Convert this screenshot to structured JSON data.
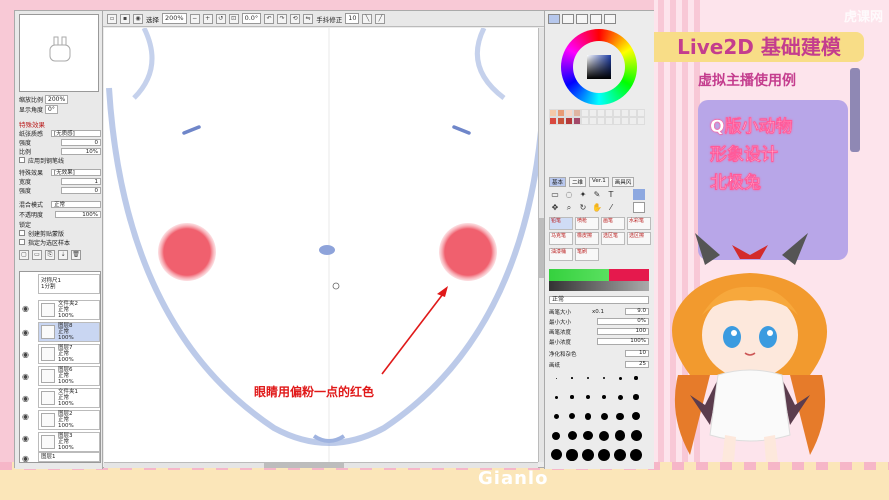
{
  "toolbar": {
    "select_label": "选择",
    "zoom": "200%",
    "angle": "0.0°",
    "stabilizer_label": "手抖修正",
    "stabilizer_value": "10"
  },
  "left_panel": {
    "zoom_label": "缩放比例",
    "zoom_value": "200%",
    "rotate_label": "显示角度",
    "rotate_value": "0°",
    "section_effects": "特殊效果",
    "paper_label": "纸张质感",
    "paper_value": "[无质感]",
    "strength_label": "强度",
    "strength_value": "0",
    "scale_label": "比例",
    "scale_value": "10%",
    "apply_brush": "应用到钢笔线",
    "effect_label": "特殊效果",
    "effect_value": "[无效果]",
    "width_label": "宽度",
    "width_value": "1",
    "effect_strength_label": "强度",
    "effect_strength_value": "0",
    "blend_label": "混合模式",
    "blend_value": "正常",
    "opacity_label": "不透明度",
    "opacity_value": "100%",
    "lock_label": "锁定",
    "clip_label": "创建剪贴蒙版",
    "select_source_label": "指定为选区样本"
  },
  "layers": [
    {
      "name": "对称尺1",
      "mode": "1分割",
      "opacity": "",
      "selected": false
    },
    {
      "name": "文件夹2",
      "mode": "正常",
      "opacity": "100%",
      "selected": false
    },
    {
      "name": "图层8",
      "mode": "正常",
      "opacity": "100%",
      "selected": true
    },
    {
      "name": "图层7",
      "mode": "正常",
      "opacity": "100%",
      "selected": false
    },
    {
      "name": "图层6",
      "mode": "正常",
      "opacity": "100%",
      "selected": false
    },
    {
      "name": "文件夹1",
      "mode": "正常",
      "opacity": "100%",
      "selected": false
    },
    {
      "name": "图层2",
      "mode": "正常",
      "opacity": "100%",
      "selected": false
    },
    {
      "name": "图层3",
      "mode": "正常",
      "opacity": "100%",
      "selected": false
    },
    {
      "name": "图层1",
      "mode": "正常",
      "opacity": "100%",
      "selected": false
    }
  ],
  "canvas": {
    "annotation": "眼睛用偏粉一点的红色",
    "blush_color": "#f0606e",
    "eye_color": "#6f86c9",
    "outline_color": "#9fb3e0"
  },
  "right_panel": {
    "tool_tabs": [
      "基本",
      "二维",
      "Ver.1",
      "画具风"
    ],
    "brush_names": [
      "铅笔",
      "喷枪",
      "画笔",
      "水彩笔",
      "马克笔",
      "橡皮擦",
      "选区笔",
      "选区擦",
      "油漆桶",
      "笔刷"
    ],
    "blend_value": "正常",
    "size_label": "画笔大小",
    "size_mult": "x0.1",
    "size_value": "9.0",
    "min_size_label": "最小大小",
    "min_size_value": "0%",
    "density_label": "画笔浓度",
    "density_value": "100",
    "min_density_label": "最小浓度",
    "min_density_value": "100%",
    "mix_label": "净化和杂色",
    "paper_label": "画纸",
    "paper_strength": "10",
    "texture_label": "画纸",
    "texture_value": "25"
  },
  "promo": {
    "title": "Live2D 基础建模",
    "subtitle": "虚拟主播使用例",
    "lines": [
      "Q版小动物",
      "形象设计",
      "北极兔"
    ],
    "watermark": "虎课网",
    "bottom_logo": "Gianlo"
  },
  "colors": {
    "frame": "#f8c9d6",
    "promo_title_bg": "#f8dd87",
    "promo_text": "#c43d8e",
    "card": "#b8a6e8",
    "annotation_red": "#e01919"
  }
}
